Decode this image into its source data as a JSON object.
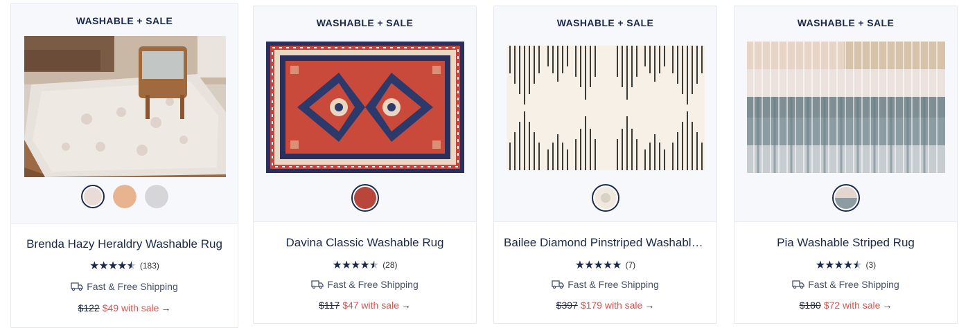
{
  "products": [
    {
      "badge": "WASHABLE + SALE",
      "name": "Brenda Hazy Heraldry Washable Rug",
      "rating": 4.5,
      "review_count": "(183)",
      "shipping": "Fast & Free Shipping",
      "original_price": "$122",
      "sale_price": "$49 with sale",
      "arrow": "→",
      "swatch_colors": [
        "#e9dcd6",
        "#e8b48f",
        "#d6d6d8"
      ],
      "selected_swatch": 0
    },
    {
      "badge": "WASHABLE + SALE",
      "name": "Davina Classic Washable Rug",
      "rating": 4.5,
      "review_count": "(28)",
      "shipping": "Fast & Free Shipping",
      "original_price": "$117",
      "sale_price": "$47 with sale",
      "arrow": "→",
      "swatch_colors": [
        "#b8463a"
      ],
      "selected_swatch": 0
    },
    {
      "badge": "WASHABLE + SALE",
      "name": "Bailee Diamond Pinstriped Washable Rug",
      "rating": 5,
      "review_count": "(7)",
      "shipping": "Fast & Free Shipping",
      "original_price": "$397",
      "sale_price": "$179 with sale",
      "arrow": "→",
      "swatch_colors": [
        "#efe9df"
      ],
      "selected_swatch": 0
    },
    {
      "badge": "WASHABLE + SALE",
      "name": "Pia Washable Striped Rug",
      "rating": 4.5,
      "review_count": "(3)",
      "shipping": "Fast & Free Shipping",
      "original_price": "$180",
      "sale_price": "$72 with sale",
      "arrow": "→",
      "swatch_colors": [
        "#c9bdb6"
      ],
      "selected_swatch": 0
    }
  ],
  "colors": {
    "navy": "#1b2a4a",
    "sale_red": "#d9534f",
    "panel_bg": "#f7f8fc"
  },
  "icons": {
    "shipping": "truck-icon",
    "rating": "star-icon"
  }
}
